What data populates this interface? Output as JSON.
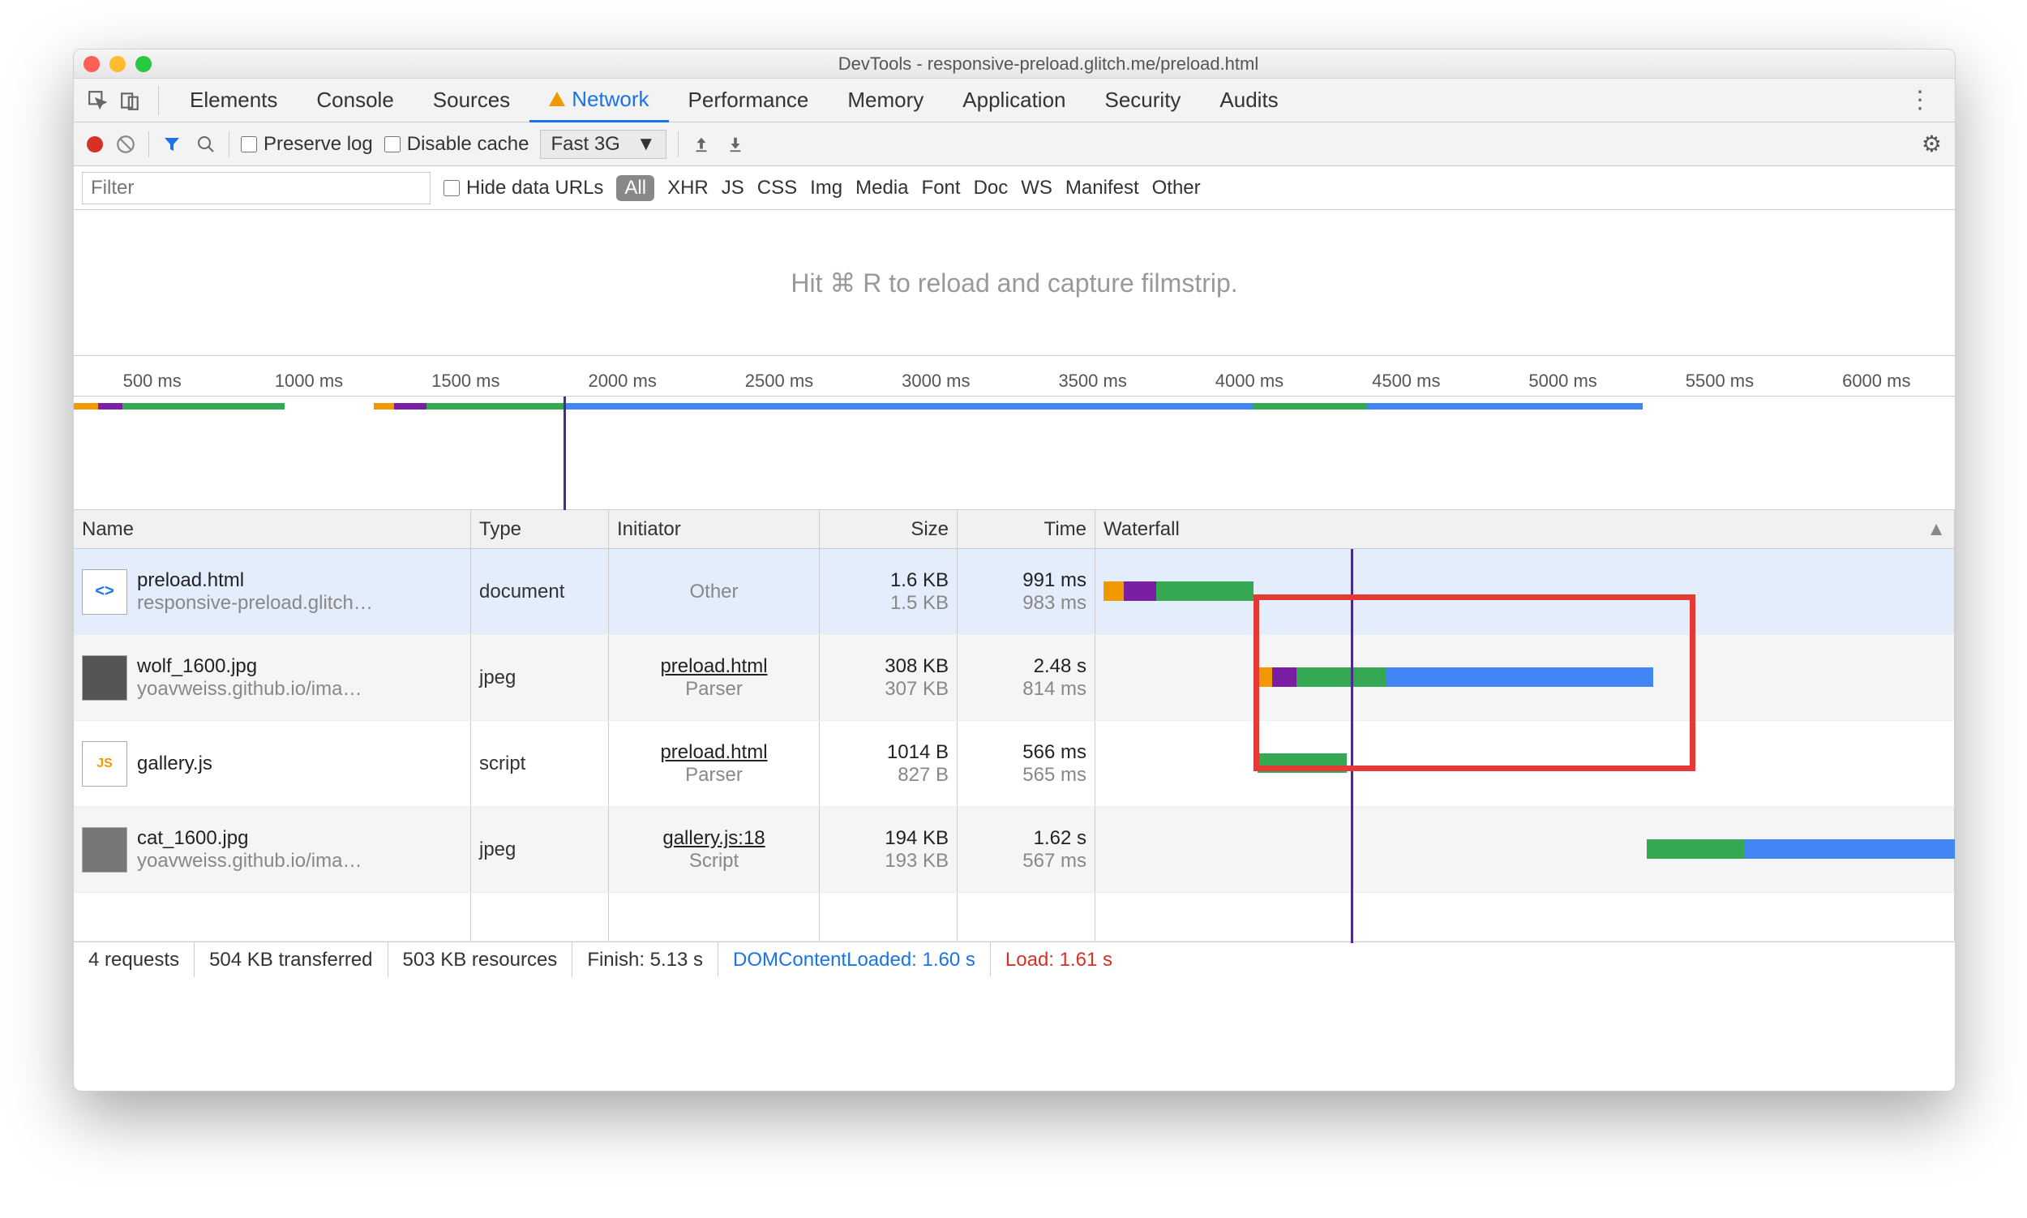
{
  "window_title": "DevTools - responsive-preload.glitch.me/preload.html",
  "tabs": [
    "Elements",
    "Console",
    "Sources",
    "Network",
    "Performance",
    "Memory",
    "Application",
    "Security",
    "Audits"
  ],
  "active_tab": "Network",
  "toolbar": {
    "preserve_log": "Preserve log",
    "disable_cache": "Disable cache",
    "throttle": "Fast 3G"
  },
  "filterbar": {
    "placeholder": "Filter",
    "hide_data_urls": "Hide data URLs",
    "types": [
      "All",
      "XHR",
      "JS",
      "CSS",
      "Img",
      "Media",
      "Font",
      "Doc",
      "WS",
      "Manifest",
      "Other"
    ]
  },
  "filmstrip_hint": "Hit ⌘ R to reload and capture filmstrip.",
  "ruler": [
    "500 ms",
    "1000 ms",
    "1500 ms",
    "2000 ms",
    "2500 ms",
    "3000 ms",
    "3500 ms",
    "4000 ms",
    "4500 ms",
    "5000 ms",
    "5500 ms",
    "6000 ms"
  ],
  "columns": {
    "name": "Name",
    "type": "Type",
    "initiator": "Initiator",
    "size": "Size",
    "time": "Time",
    "waterfall": "Waterfall"
  },
  "rows": [
    {
      "name": "preload.html",
      "sub": "responsive-preload.glitch…",
      "type": "document",
      "initiator": "Other",
      "init_sub": "",
      "size": "1.6 KB",
      "size2": "1.5 KB",
      "time": "991 ms",
      "time2": "983 ms",
      "selected": true
    },
    {
      "name": "wolf_1600.jpg",
      "sub": "yoavweiss.github.io/ima…",
      "type": "jpeg",
      "initiator": "preload.html",
      "init_sub": "Parser",
      "size": "308 KB",
      "size2": "307 KB",
      "time": "2.48 s",
      "time2": "814 ms"
    },
    {
      "name": "gallery.js",
      "sub": "",
      "type": "script",
      "initiator": "preload.html",
      "init_sub": "Parser",
      "size": "1014 B",
      "size2": "827 B",
      "time": "566 ms",
      "time2": "565 ms"
    },
    {
      "name": "cat_1600.jpg",
      "sub": "yoavweiss.github.io/ima…",
      "type": "jpeg",
      "initiator": "gallery.js:18",
      "init_sub": "Script",
      "size": "194 KB",
      "size2": "193 KB",
      "time": "1.62 s",
      "time2": "567 ms"
    }
  ],
  "status": {
    "requests": "4 requests",
    "transferred": "504 KB transferred",
    "resources": "503 KB resources",
    "finish": "Finish: 5.13 s",
    "dcl": "DOMContentLoaded: 1.60 s",
    "load": "Load: 1.61 s"
  }
}
